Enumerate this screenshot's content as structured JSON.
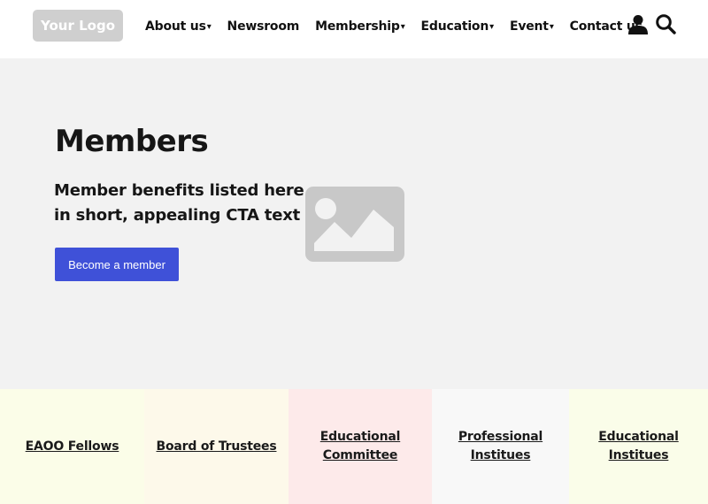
{
  "header": {
    "logo_text": "Your Logo",
    "nav": [
      {
        "label": "About us",
        "has_dropdown": true
      },
      {
        "label": "Newsroom",
        "has_dropdown": false
      },
      {
        "label": "Membership",
        "has_dropdown": true
      },
      {
        "label": "Education",
        "has_dropdown": true
      },
      {
        "label": "Event",
        "has_dropdown": true
      },
      {
        "label": "Contact us",
        "has_dropdown": false
      }
    ],
    "dropdown_caret": "▾",
    "icons": [
      "user-icon",
      "search-icon"
    ]
  },
  "hero": {
    "title": "Members",
    "subtitle": "Member benefits listed here in short, appealing CTA text",
    "cta_label": "Become a member",
    "image_icon": "image-placeholder-icon"
  },
  "tiles": [
    {
      "label": "EAOO Fellows",
      "bg": "#fbfde8"
    },
    {
      "label": "Board of Trustees",
      "bg": "#fdf9ea"
    },
    {
      "label": "Educational Committee",
      "bg": "#fdeaea"
    },
    {
      "label": "Professional Institues",
      "bg": "#f8f8f8"
    },
    {
      "label": "Educational Institues",
      "bg": "#fafde9"
    }
  ],
  "colors": {
    "accent": "#3f51d8",
    "hero_bg": "#f2f2f2",
    "logo_bg": "#cfcfcf",
    "placeholder": "#c8c8c8"
  }
}
